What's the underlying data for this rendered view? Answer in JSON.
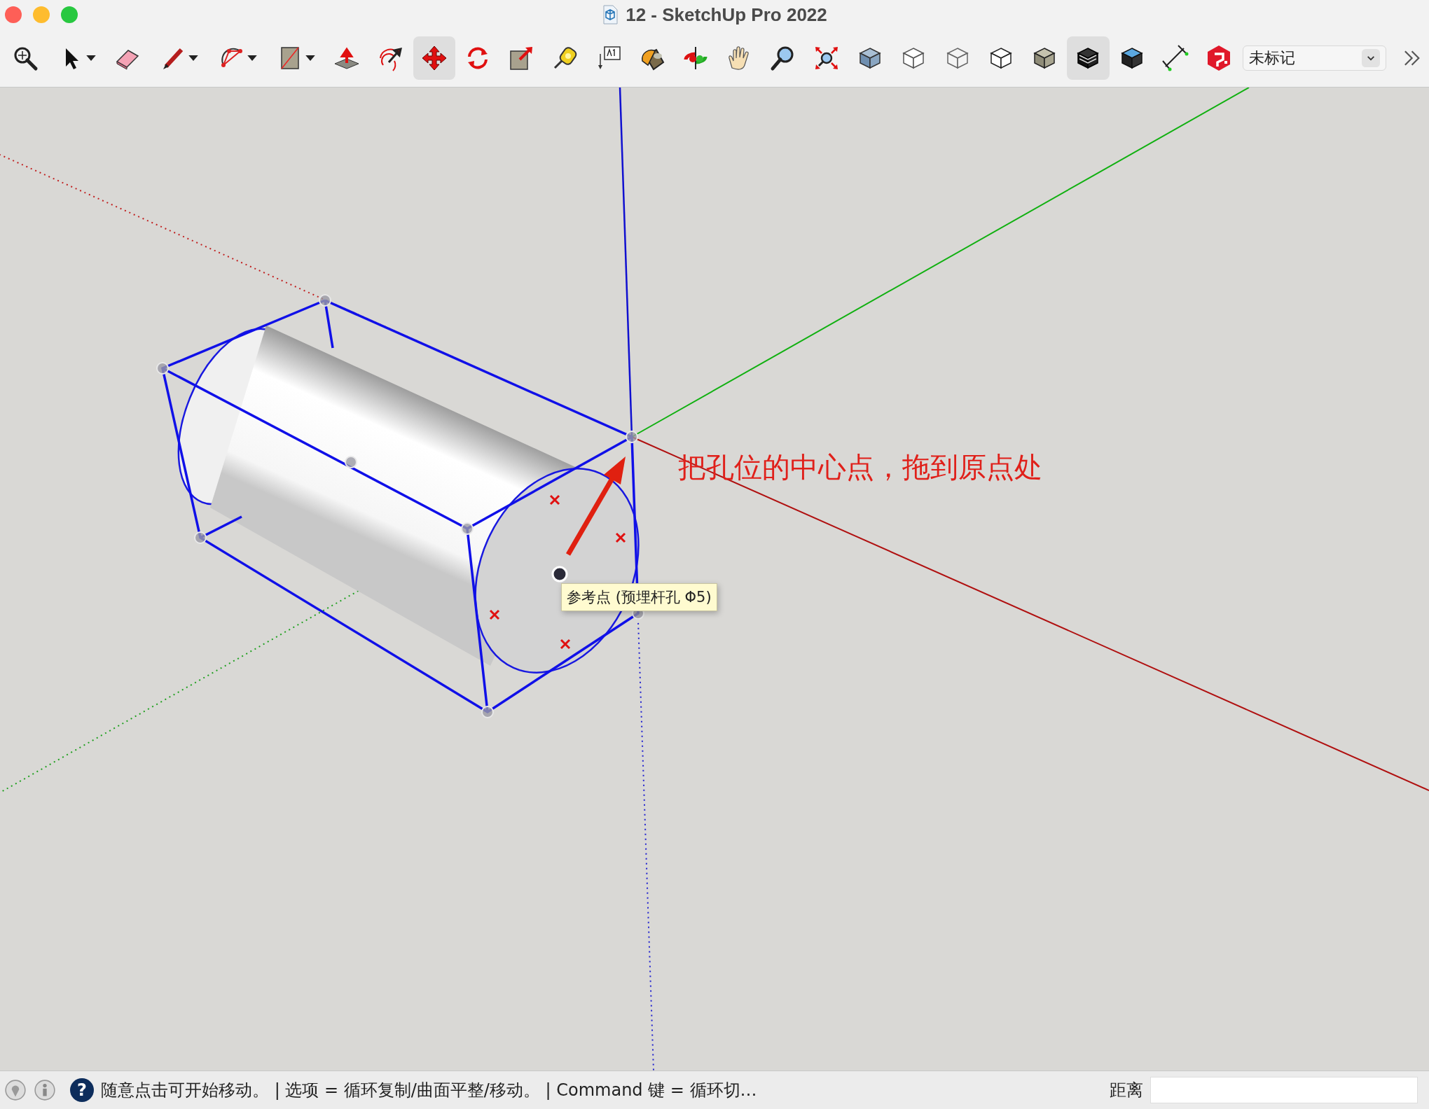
{
  "window": {
    "title": "12 - SketchUp Pro 2022"
  },
  "toolbar": {
    "tools": [
      {
        "kind": "zoom-window",
        "selected": false,
        "dropdown": false
      },
      {
        "kind": "select",
        "selected": false,
        "dropdown": true
      },
      {
        "kind": "eraser",
        "selected": false,
        "dropdown": false
      },
      {
        "kind": "pencil",
        "selected": false,
        "dropdown": true
      },
      {
        "kind": "arc",
        "selected": false,
        "dropdown": true
      },
      {
        "kind": "rectangle",
        "selected": false,
        "dropdown": true
      },
      {
        "kind": "push-pull",
        "selected": false,
        "dropdown": false
      },
      {
        "kind": "follow-me",
        "selected": false,
        "dropdown": false
      },
      {
        "kind": "move",
        "selected": true,
        "dropdown": false
      },
      {
        "kind": "rotate",
        "selected": false,
        "dropdown": false
      },
      {
        "kind": "scale",
        "selected": false,
        "dropdown": false
      },
      {
        "kind": "tape",
        "selected": false,
        "dropdown": false
      },
      {
        "kind": "text",
        "selected": false,
        "dropdown": false
      },
      {
        "kind": "paint",
        "selected": false,
        "dropdown": false
      },
      {
        "kind": "orbit",
        "selected": false,
        "dropdown": false
      },
      {
        "kind": "pan",
        "selected": false,
        "dropdown": false
      },
      {
        "kind": "zoom",
        "selected": false,
        "dropdown": false
      },
      {
        "kind": "zoom-extents",
        "selected": false,
        "dropdown": false
      },
      {
        "kind": "xray",
        "selected": false,
        "dropdown": false
      },
      {
        "kind": "back-edges",
        "selected": false,
        "dropdown": false
      },
      {
        "kind": "wireframe",
        "selected": false,
        "dropdown": false
      },
      {
        "kind": "hidden-line",
        "selected": false,
        "dropdown": false
      },
      {
        "kind": "shaded",
        "selected": false,
        "dropdown": false
      },
      {
        "kind": "textured",
        "selected": true,
        "dropdown": false
      },
      {
        "kind": "monochrome",
        "selected": false,
        "dropdown": false
      },
      {
        "kind": "dimension",
        "selected": false,
        "dropdown": false
      },
      {
        "kind": "extension",
        "selected": false,
        "dropdown": false
      }
    ],
    "tag_dropdown": {
      "value": "未标记"
    }
  },
  "canvas": {
    "annotation": "把孔位的中心点，拖到原点处",
    "tooltip": "参考点 (预埋杆孔 Φ5)"
  },
  "status_bar": {
    "help_icon": "?",
    "message": "随意点击可开始移动。 | 选项 = 循环复制/曲面平整/移动。 | Command 键 = 循环切…",
    "measurement_label": "距离"
  }
}
